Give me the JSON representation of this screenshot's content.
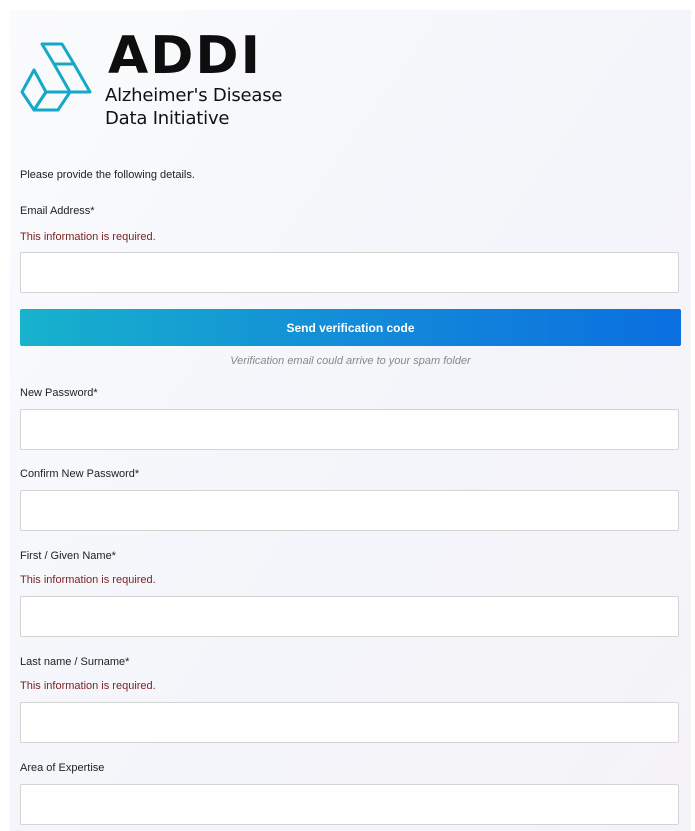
{
  "logo": {
    "word": "ADDI",
    "line1": "Alzheimer's Disease",
    "line2": "Data Initiative"
  },
  "intro": "Please provide the following details.",
  "email": {
    "label": "Email Address*",
    "error": "This information is required.",
    "value": "",
    "placeholder": ""
  },
  "verify_button": "Send verification code",
  "verify_hint": "Verification email could arrive to your spam folder",
  "new_password": {
    "label": "New Password*",
    "value": ""
  },
  "confirm_password": {
    "label": "Confirm New Password*",
    "value": ""
  },
  "first_name": {
    "label": "First / Given Name*",
    "error": "This information is required.",
    "value": ""
  },
  "last_name": {
    "label": "Last name / Surname*",
    "error": "This information is required.",
    "value": ""
  },
  "expertise": {
    "label": "Area of Expertise",
    "value": ""
  },
  "colors": {
    "brand_cyan": "#17b2cc",
    "brand_blue": "#0b6fe0",
    "error_red": "#7a1f1f"
  }
}
